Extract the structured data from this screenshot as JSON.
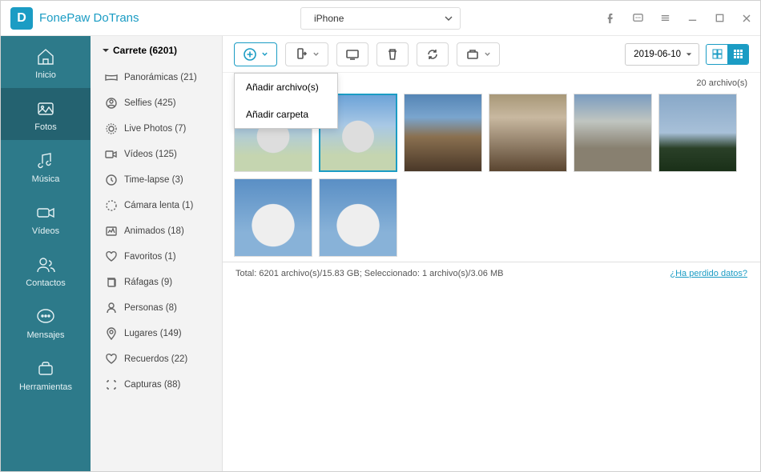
{
  "app_title": "FonePaw DoTrans",
  "device": {
    "name": "iPhone"
  },
  "nav": [
    {
      "id": "home",
      "label": "Inicio"
    },
    {
      "id": "photos",
      "label": "Fotos"
    },
    {
      "id": "music",
      "label": "Música"
    },
    {
      "id": "videos",
      "label": "Vídeos"
    },
    {
      "id": "contacts",
      "label": "Contactos"
    },
    {
      "id": "messages",
      "label": "Mensajes"
    },
    {
      "id": "tools",
      "label": "Herramientas"
    }
  ],
  "albums": {
    "head": "Carrete (6201)",
    "items": [
      {
        "label": "Panorámicas (21)"
      },
      {
        "label": "Selfies (425)"
      },
      {
        "label": "Live Photos (7)"
      },
      {
        "label": "Vídeos (125)"
      },
      {
        "label": "Time-lapse (3)"
      },
      {
        "label": "Cámara lenta (1)"
      },
      {
        "label": "Animados (18)"
      },
      {
        "label": "Favoritos (1)"
      },
      {
        "label": "Ráfagas (9)"
      },
      {
        "label": "Personas (8)"
      },
      {
        "label": "Lugares (149)"
      },
      {
        "label": "Recuerdos (22)"
      },
      {
        "label": "Capturas (88)"
      }
    ]
  },
  "dropdown": {
    "add_files": "Añadir archivo(s)",
    "add_folder": "Añadir carpeta"
  },
  "date_picker": "2019-06-10",
  "date_count": "20 archivo(s)",
  "status": {
    "left": "Total: 6201 archivo(s)/15.83 GB; Seleccionado: 1 archivo(s)/3.06 MB",
    "right": "¿Ha perdido datos?"
  },
  "colors": {
    "accent": "#1b9cc4",
    "nav": "#2d7a8a"
  }
}
